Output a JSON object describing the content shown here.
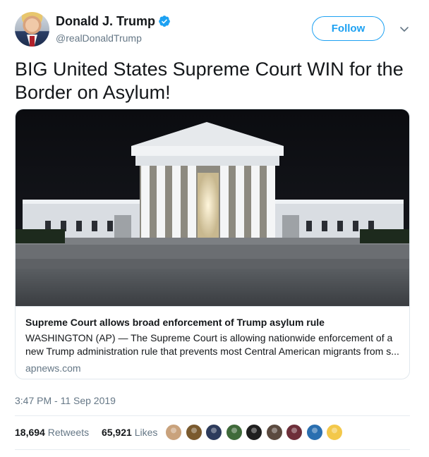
{
  "author": {
    "display_name": "Donald J. Trump",
    "handle": "@realDonaldTrump",
    "verified": true
  },
  "follow_label": "Follow",
  "tweet": {
    "text": "BIG United States Supreme Court WIN for the Border on Asylum!"
  },
  "card": {
    "title": "Supreme Court allows broad enforcement of Trump asylum rule",
    "description": "WASHINGTON (AP) — The Supreme Court is allowing nationwide enforcement of a new Trump administration rule that prevents most Central American migrants from s...",
    "domain": "apnews.com"
  },
  "timestamp": "3:47 PM - 11 Sep 2019",
  "stats": {
    "retweets_count": "18,694",
    "retweets_label": "Retweets",
    "likes_count": "65,921",
    "likes_label": "Likes"
  },
  "colors": {
    "accent": "#1da1f2",
    "secondary_text": "#657786",
    "primary_text": "#14171a"
  },
  "icons": {
    "verified": "verified-badge-icon",
    "more": "chevron-down-icon"
  },
  "likers": [
    {
      "color": "#c9a27c"
    },
    {
      "color": "#7a5a2e"
    },
    {
      "color": "#2d3b5c"
    },
    {
      "color": "#3f6a3a"
    },
    {
      "color": "#1f1f1f"
    },
    {
      "color": "#5b4a3f"
    },
    {
      "color": "#6e2f3a"
    },
    {
      "color": "#2a6fb0"
    },
    {
      "color": "#f3c84a"
    }
  ]
}
